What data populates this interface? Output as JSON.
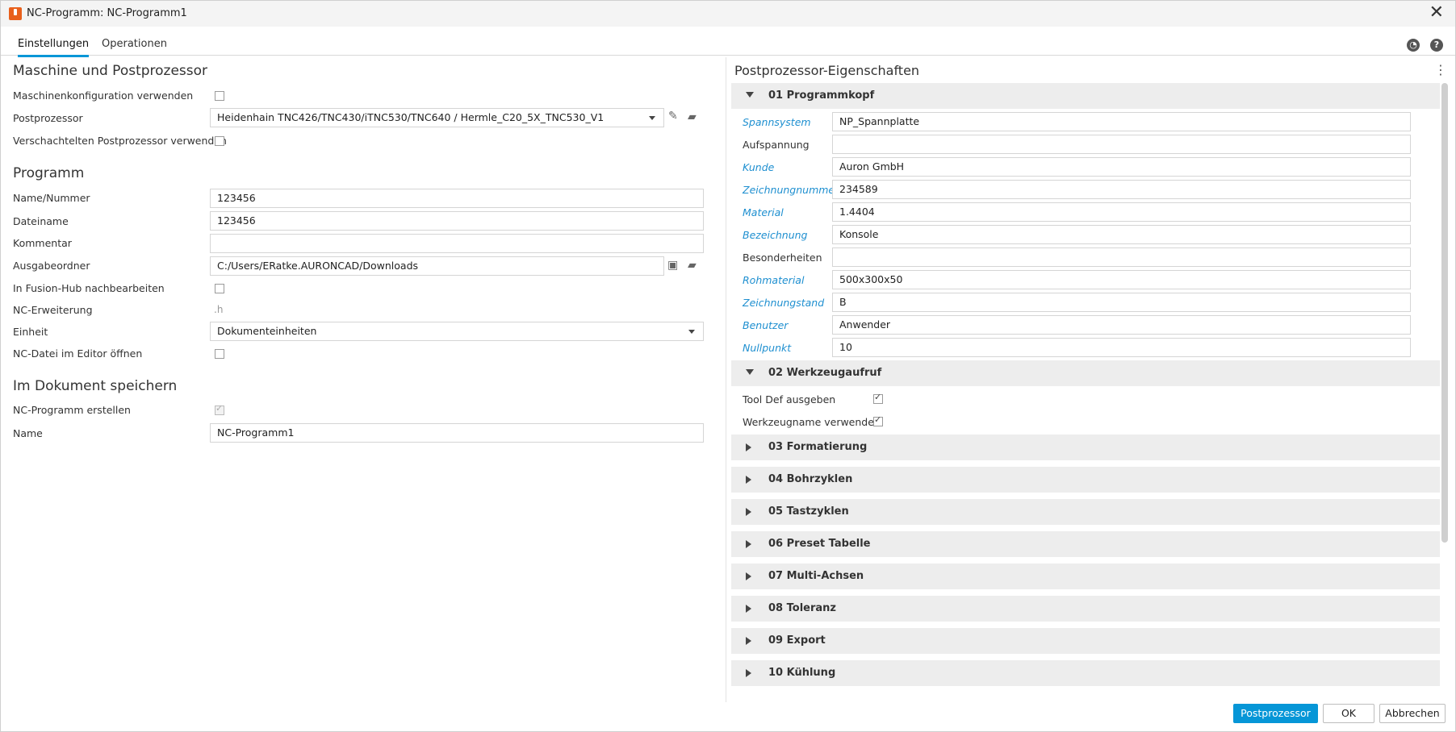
{
  "window": {
    "title": "NC-Programm: NC-Programm1",
    "close_glyph": "✕"
  },
  "tabs": [
    "Einstellungen",
    "Operationen"
  ],
  "left": {
    "section_machine": "Maschine und Postprozessor",
    "machine_config_label": "Maschinenkonfiguration verwenden",
    "postprocessor_label": "Postprozessor",
    "postprocessor_value": "Heidenhain TNC426/TNC430/iTNC530/TNC640 / Hermle_C20_5X_TNC530_V1",
    "nested_pp_label": "Verschachtelten Postprozessor verwenden",
    "section_program": "Programm",
    "name_number_label": "Name/Nummer",
    "name_number_value": "123456",
    "filename_label": "Dateiname",
    "filename_value": "123456",
    "comment_label": "Kommentar",
    "comment_value": "",
    "output_folder_label": "Ausgabeordner",
    "output_folder_value": "C:/Users/ERatke.AURONCAD/Downloads",
    "fusion_hub_label": "In Fusion-Hub nachbearbeiten",
    "nc_ext_label": "NC-Erweiterung",
    "nc_ext_value": ".h",
    "unit_label": "Einheit",
    "unit_value": "Dokumenteinheiten",
    "open_editor_label": "NC-Datei im Editor öffnen",
    "section_save": "Im Dokument speichern",
    "create_nc_label": "NC-Programm erstellen",
    "name_label": "Name",
    "name_value": "NC-Programm1"
  },
  "right": {
    "title": "Postprozessor-Eigenschaften",
    "group01": "01 Programmkopf",
    "props": [
      {
        "label": "Spannsystem",
        "value": "NP_Spannplatte"
      },
      {
        "label": "Aufspannung",
        "value": ""
      },
      {
        "label": "Kunde",
        "value": "Auron GmbH"
      },
      {
        "label": "Zeichnungnummer",
        "value": "234589"
      },
      {
        "label": "Material",
        "value": "1.4404"
      },
      {
        "label": "Bezeichnung",
        "value": "Konsole"
      },
      {
        "label": "Besonderheiten",
        "value": ""
      },
      {
        "label": "Rohmaterial",
        "value": "500x300x50"
      },
      {
        "label": "Zeichnungstand",
        "value": "B"
      },
      {
        "label": "Benutzer",
        "value": "Anwender"
      },
      {
        "label": "Nullpunkt",
        "value": "10"
      }
    ],
    "group02": "02 Werkzeugaufruf",
    "tool_def_label": "Tool Def ausgeben",
    "tool_name_label": "Werkzeugname verwenden",
    "groups": [
      "03 Formatierung",
      "04 Bohrzyklen",
      "05 Tastzyklen",
      "06 Preset Tabelle",
      "07 Multi-Achsen",
      "08 Toleranz",
      "09 Export",
      "10 Kühlung"
    ]
  },
  "buttons": {
    "postprocessor": "Postprozessor",
    "ok": "OK",
    "cancel": "Abbrechen"
  },
  "colors": {
    "accent": "#0696d7",
    "modified_label": "#1e8fd0"
  }
}
